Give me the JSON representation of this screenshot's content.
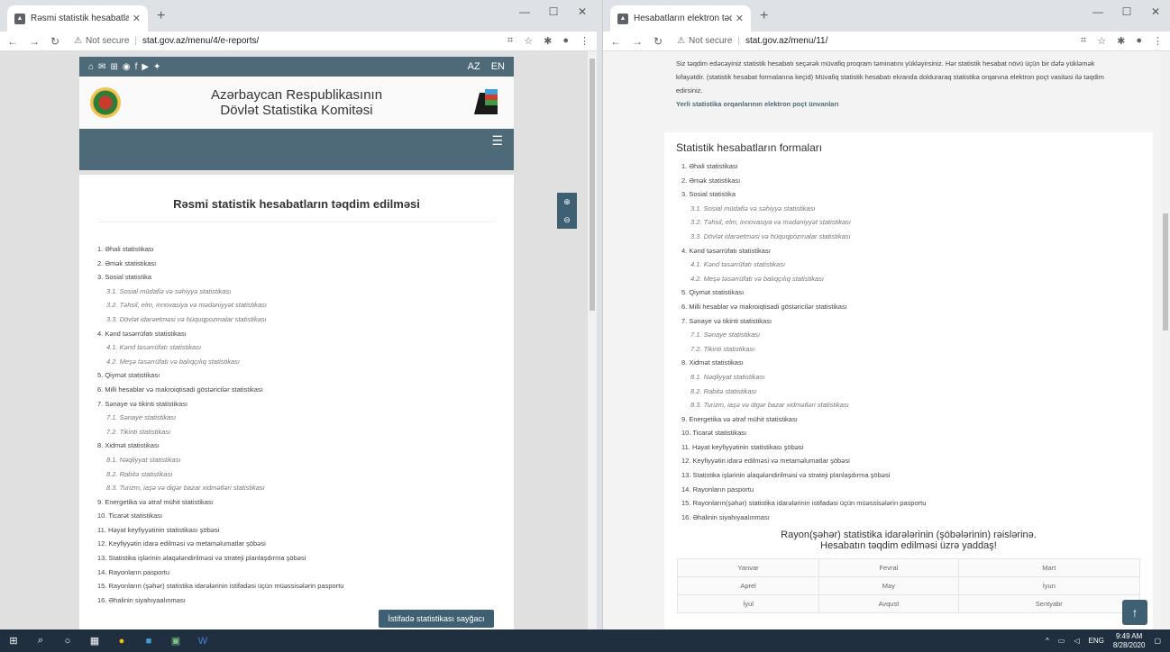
{
  "left_window": {
    "tab_title": "Rəsmi statistik hesabatların təqdi",
    "url": "stat.gov.az/menu/4/e-reports/",
    "not_secure": "Not secure",
    "header": {
      "langs": [
        "AZ",
        "EN"
      ],
      "title_line1": "Azərbaycan Respublikasının",
      "title_line2": "Dövlət Statistika Komitəsi"
    },
    "page_title": "Rəsmi statistik hesabatların təqdim edilməsi",
    "items": [
      {
        "text": "1. Əhali statistikası",
        "sub": false
      },
      {
        "text": "2. Əmək statistikası",
        "sub": false
      },
      {
        "text": "3. Sosial statistika",
        "sub": false
      },
      {
        "text": "3.1. Sosial müdafiə və səhiyyə statistikası",
        "sub": true
      },
      {
        "text": "3.2. Təhsil, elm, innovasiya və mədəniyyət statistikası",
        "sub": true
      },
      {
        "text": "3.3. Dövlət idarəetməsi və hüquqpozmalar statistikası",
        "sub": true
      },
      {
        "text": "4. Kənd təsərrüfatı statistikası",
        "sub": false
      },
      {
        "text": "4.1. Kənd təsərrüfatı statistikası",
        "sub": true
      },
      {
        "text": "4.2. Meşə təsərrüfatı və balıqçılıq statistikası",
        "sub": true
      },
      {
        "text": "5. Qiymət statistikası",
        "sub": false
      },
      {
        "text": "6. Milli hesablar və makroiqtisadi göstəricilər statistikası",
        "sub": false
      },
      {
        "text": "7. Sənaye və tikinti statistikası",
        "sub": false
      },
      {
        "text": "7.1. Sənaye statistikası",
        "sub": true
      },
      {
        "text": "7.2. Tikinti statistikası",
        "sub": true
      },
      {
        "text": "8. Xidmət statistikası",
        "sub": false
      },
      {
        "text": "8.1. Nəqliyyat statistikası",
        "sub": true
      },
      {
        "text": "8.2. Rabitə statistikası",
        "sub": true
      },
      {
        "text": "8.3. Turizm, iaşə və digər bazar xidmətləri statistikası",
        "sub": true
      },
      {
        "text": "9. Energetika və ətraf mühit statistikası",
        "sub": false
      },
      {
        "text": "10. Ticarət statistikası",
        "sub": false
      },
      {
        "text": "11. Həyat keyfiyyətinin statistikası şöbəsi",
        "sub": false
      },
      {
        "text": "12. Keyfiyyətin idarə edilməsi və metaməlumatlar şöbəsi",
        "sub": false
      },
      {
        "text": "13. Statistika işlərinin əlaqələndirilməsi və strateji planlaşdırma şöbəsi",
        "sub": false
      },
      {
        "text": "14. Rayonların pasportu",
        "sub": false
      },
      {
        "text": "15. Rayonların (şəhər) statistika idarələrinin istifadəsi üçün müəssisələrin pasportu",
        "sub": false
      },
      {
        "text": "16. Əhalinin siyahıyaalınması",
        "sub": false
      }
    ],
    "counter_button": "İstifadə statistikası sayğacı"
  },
  "right_window": {
    "tab_title": "Hesabatların elektron təqdimatı",
    "url": "stat.gov.az/menu/11/",
    "not_secure": "Not secure",
    "intro": "Siz təqdim edəcəyiniz statistik hesabatı seçərək müvafiq proqram təminatını yükləyirsiniz. Hər statistik hesabat növü üçün bir dəfə yükləmək kifayətdir. (statistik hesabat formalarına keçid) Müvafiq statistik hesabatı ekranda dolduraraq statistika orqanına elektron poçt vasitəsi ilə təqdim edirsiniz.",
    "intro_link": "Yerli statistika orqanlarının elektron poçt ünvanları",
    "forms_title": "Statistik hesabatların formaları",
    "items": [
      {
        "text": "1. Əhali statistikası",
        "sub": false
      },
      {
        "text": "2. Əmək statistikası",
        "sub": false
      },
      {
        "text": "3. Sosial statistika",
        "sub": false
      },
      {
        "text": "3.1. Sosial müdafiə və səhiyyə statistikası",
        "sub": true
      },
      {
        "text": "3.2. Təhsil, elm, innovasiya və mədəniyyət statistikası",
        "sub": true
      },
      {
        "text": "3.3. Dövlət idarəetməsi və hüquqpozmalar statistikası",
        "sub": true
      },
      {
        "text": "4. Kənd təsərrüfatı statistikası",
        "sub": false
      },
      {
        "text": "4.1. Kənd təsərrüfatı statistikası",
        "sub": true
      },
      {
        "text": "4.2. Meşə təsərrüfatı və balıqçılıq statistikası",
        "sub": true
      },
      {
        "text": "5. Qiymət statistikası",
        "sub": false
      },
      {
        "text": "6. Milli hesablar və makroiqtisadi göstəricilər statistikası",
        "sub": false
      },
      {
        "text": "7. Sənaye və tikinti statistikası",
        "sub": false
      },
      {
        "text": "7.1. Sənaye statistikası",
        "sub": true
      },
      {
        "text": "7.2. Tikinti statistikası",
        "sub": true
      },
      {
        "text": "8. Xidmət statistikası",
        "sub": false
      },
      {
        "text": "8.1. Nəqliyyat statistikası",
        "sub": true
      },
      {
        "text": "8.2. Rabitə statistikası",
        "sub": true
      },
      {
        "text": "8.3. Turizm, iaşə və digər bazar xidmətləri statistikası",
        "sub": true
      },
      {
        "text": "9. Energetika və ətraf mühit statistikası",
        "sub": false
      },
      {
        "text": "10. Ticarət statistikası",
        "sub": false
      },
      {
        "text": "11. Həyat keyfiyyətinin statistikası şöbəsi",
        "sub": false
      },
      {
        "text": "12. Keyfiyyətin idarə edilməsi və metaməlumatlar şöbəsi",
        "sub": false
      },
      {
        "text": "13. Statistika işlərinin əlaqələndirilməsi və strateji planlaşdırma şöbəsi",
        "sub": false
      },
      {
        "text": "14. Rayonların pasportu",
        "sub": false
      },
      {
        "text": "15. Rayonların(şəhər) statistika idarələrinin istifadəsi üçün müəssisələrin pasportu",
        "sub": false
      },
      {
        "text": "16. Əhalinin siyahıyaalınması",
        "sub": false
      }
    ],
    "reminder_line1": "Rayon(şəhər) statistika idarələrinin (şöbələrinin) rəislərinə.",
    "reminder_line2": "Hesabatın təqdim edilməsi üzrə yaddaş!",
    "months": [
      [
        "Yanvar",
        "Fevral",
        "Mart"
      ],
      [
        "Aprel",
        "May",
        "İyun"
      ],
      [
        "İyul",
        "Avqust",
        "Sentyabr"
      ]
    ]
  },
  "taskbar": {
    "tray_lang": "ENG",
    "time": "9:49 AM",
    "date": "8/28/2020"
  },
  "colors": {
    "header_bg": "#4e6977",
    "accent": "#3f6073",
    "taskbar": "#1f2f3f"
  }
}
